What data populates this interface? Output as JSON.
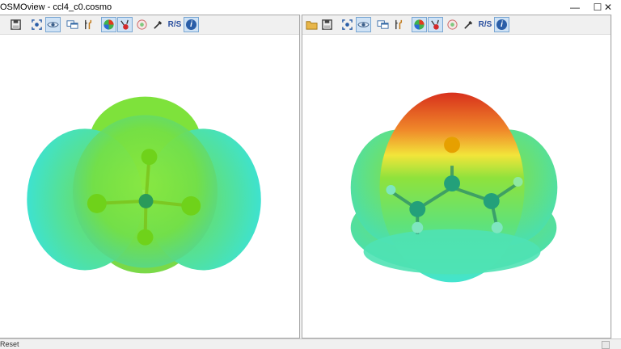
{
  "window": {
    "title": "OSMOview - ccl4_c0.cosmo",
    "minimize_glyph": "—",
    "maximize_glyph": "☐",
    "close_glyph": "✕"
  },
  "left_toolbar": [
    "save-icon",
    "zoom-fit-icon",
    "eye-icon",
    "window-icon",
    "tools-icon",
    "sigma-surface-icon",
    "charges-icon",
    "polar-icon",
    "pipette-icon",
    "rs-label-icon",
    "info-icon"
  ],
  "right_toolbar": [
    "open-folder-icon",
    "save-icon",
    "zoom-fit-icon",
    "eye-icon",
    "window-icon",
    "tools-icon",
    "sigma-surface-icon",
    "charges-icon",
    "polar-icon",
    "pipette-icon",
    "rs-label-icon",
    "info-icon"
  ],
  "rs_label": "R/S",
  "info_label": "i",
  "status": {
    "text": "Reset"
  },
  "colors": {
    "surface_green": "#7be33a",
    "surface_cyan": "#45e7c6",
    "surface_red": "#e23a1c",
    "atom_cl": "#7cd41a",
    "atom_c": "#2aa07a",
    "atom_o": "#e6a000"
  }
}
